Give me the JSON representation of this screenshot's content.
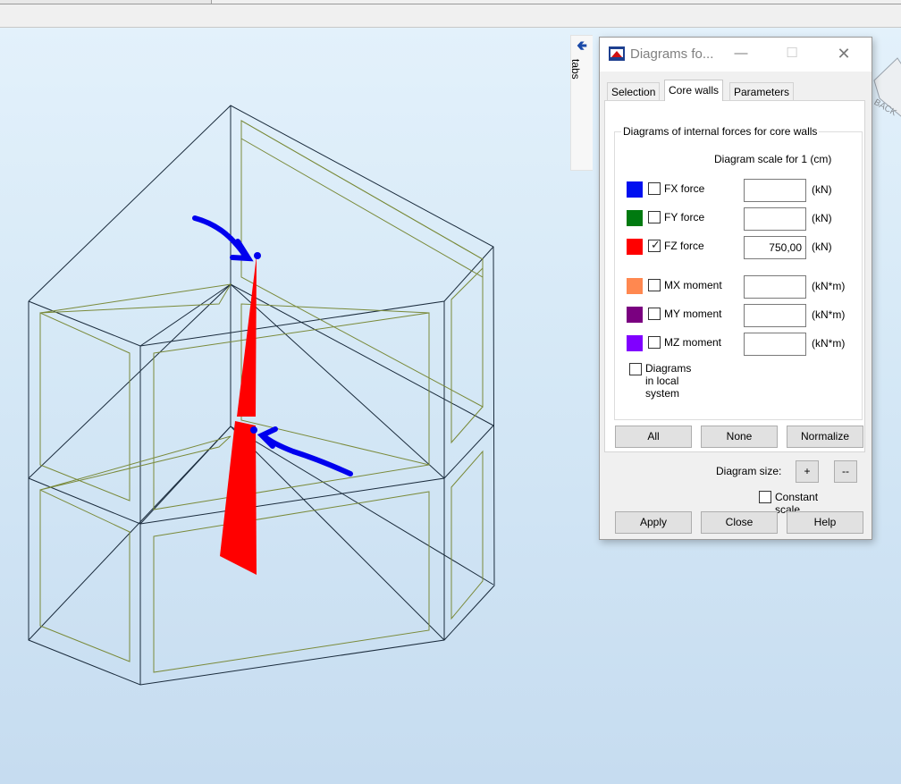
{
  "viewport": {
    "side_tab_label": "tabs",
    "cube_label": "BACK"
  },
  "dialog": {
    "title": "Diagrams fo...",
    "tabs": [
      {
        "label": "Selection",
        "active": false
      },
      {
        "label": "Core walls",
        "active": true
      },
      {
        "label": "Parameters",
        "active": false
      }
    ],
    "group_title": "Diagrams of internal forces for core walls",
    "scale_label": "Diagram scale for 1 (cm)",
    "rows": [
      {
        "label": "FX force",
        "color": "#0010f0",
        "checked": false,
        "value": "",
        "unit": "(kN)"
      },
      {
        "label": "FY force",
        "color": "#007a10",
        "checked": false,
        "value": "",
        "unit": "(kN)"
      },
      {
        "label": "FZ force",
        "color": "#ff0000",
        "checked": true,
        "value": "750,00",
        "unit": "(kN)"
      },
      {
        "label": "MX moment",
        "color": "#ff8850",
        "checked": false,
        "value": "",
        "unit": "(kN*m)"
      },
      {
        "label": "MY moment",
        "color": "#7a0080",
        "checked": false,
        "value": "",
        "unit": "(kN*m)"
      },
      {
        "label": "MZ moment",
        "color": "#8000ff",
        "checked": false,
        "value": "",
        "unit": "(kN*m)"
      }
    ],
    "local_system_label": "Diagrams in local system",
    "buttons": {
      "all": "All",
      "none": "None",
      "normalize": "Normalize"
    },
    "size_label": "Diagram size:",
    "size_plus": "+",
    "size_minus": "--",
    "constant_scale_label": "Constant scale",
    "footer": {
      "apply": "Apply",
      "close": "Close",
      "help": "Help"
    }
  },
  "colors": {
    "diagram": "#ff0000",
    "annotation_arrow": "#0000ee",
    "structure_edges": "#1a2b3c",
    "inner_walls": "#7a8a3a"
  }
}
